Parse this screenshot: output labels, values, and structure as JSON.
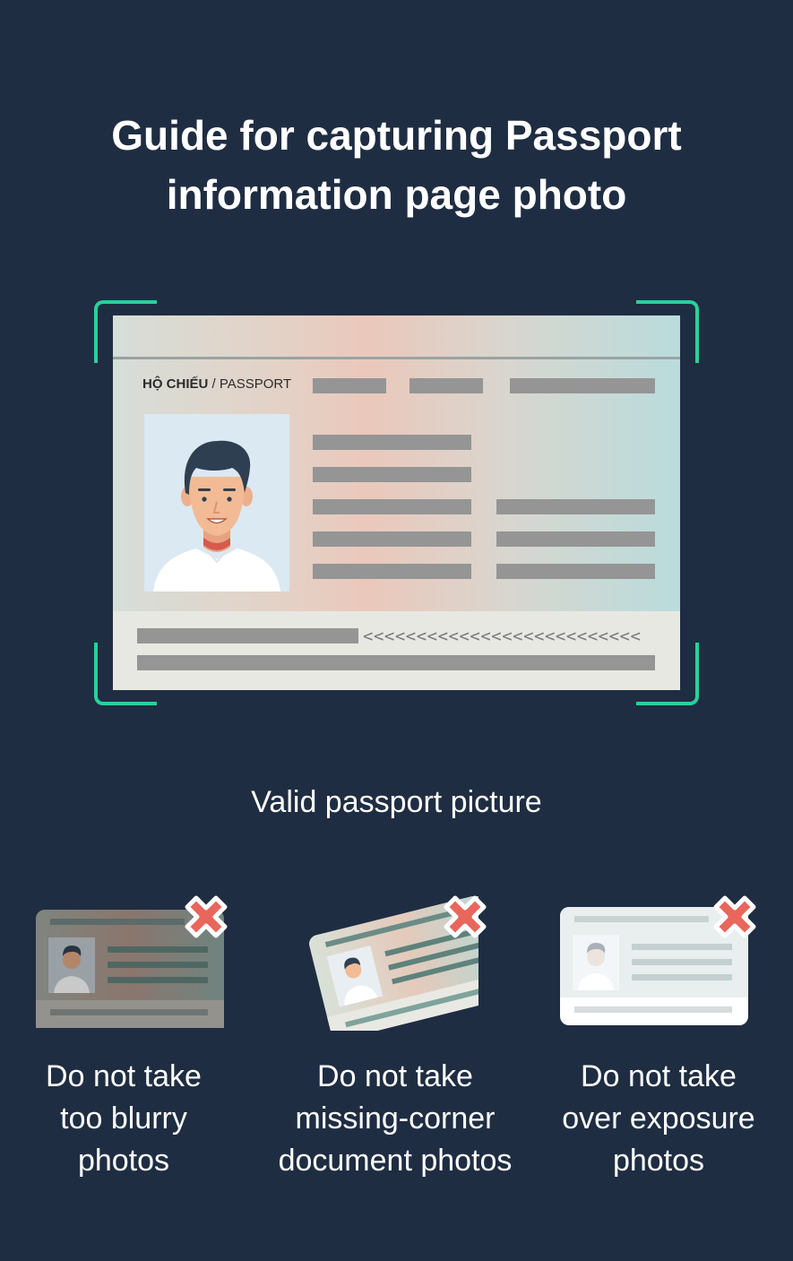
{
  "title": {
    "line1": "Guide for capturing Passport",
    "line2": "information page photo"
  },
  "passport": {
    "label_bold": "HỘ CHIẾU",
    "label_rest": "/ PASSPORT",
    "mrz_chevrons": "<<<<<<<<<<<<<<<<<<<<<<<<<<"
  },
  "valid_caption": "Valid passport picture",
  "examples": [
    {
      "line1": "Do not take",
      "line2": "too blurry",
      "line3": "photos"
    },
    {
      "line1": "Do not take",
      "line2": "missing-corner",
      "line3": "document photos"
    },
    {
      "line1": "Do not take",
      "line2": "over exposure",
      "line3": "photos"
    }
  ],
  "colors": {
    "background": "#1f2d42",
    "frame_accent": "#29d19a",
    "reject_mark": "#e8665c"
  },
  "icons": [
    "avatar-illustration",
    "reject-x-icon"
  ]
}
